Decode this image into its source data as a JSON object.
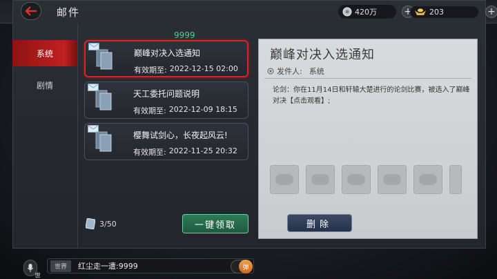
{
  "header": {
    "title": "邮件"
  },
  "currency": [
    {
      "icon": "silver-coin-icon",
      "value": "420万"
    },
    {
      "icon": "gold-ingot-icon",
      "value": "203"
    }
  ],
  "tabs": [
    {
      "label": "系统",
      "active": true
    },
    {
      "label": "剧情",
      "active": false
    }
  ],
  "mail_list": {
    "count_badge": "9999",
    "expiry_label": "有效期至:",
    "items": [
      {
        "title": "巅峰对决入选通知",
        "expiry": "2022-12-15 02:00",
        "selected": true
      },
      {
        "title": "天工委托问题说明",
        "expiry": "2022-12-09 18:15",
        "selected": false
      },
      {
        "title": "樱舞试剑心，长夜起风云!",
        "expiry": "2022-11-25 20:32",
        "selected": false
      }
    ],
    "page_info": "3/50",
    "claim_all_label": "一键领取"
  },
  "detail": {
    "title": "巅峰对决入选通知",
    "sender_label": "发件人:",
    "sender": "系统",
    "body": "论剑：你在11月14日和轩辕大楚进行的论剑比赛，被选入了巅峰对决【点击观看】;",
    "reward_slots": 6,
    "delete_label": "删除"
  },
  "chat": {
    "mic_label": "世",
    "channel": "世界",
    "message": "红尘走一遭:9999",
    "danmu_label": "弹"
  },
  "colors": {
    "accent_red": "#c02020",
    "claim_green": "#2e7a56",
    "count_green": "#4fd18a"
  }
}
